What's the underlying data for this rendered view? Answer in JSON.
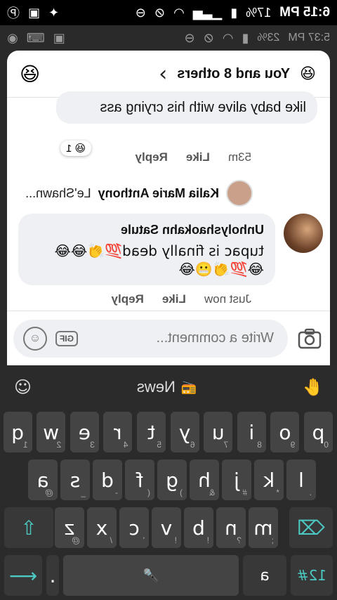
{
  "status": {
    "time": "6:15 PM",
    "battery": "17%",
    "signal_icon": "signal-icon",
    "wifi_icon": "wifi-icon"
  },
  "inner_status": {
    "time": "5:37 PM",
    "battery": "23%"
  },
  "header": {
    "title": "You and 8 others"
  },
  "comments": [
    {
      "text": "like baby alive with his crying ass",
      "reaction_count": "1",
      "time": "53m",
      "like": "Like",
      "reply": "Reply"
    },
    {
      "name": "Unholyshaokahn Satule",
      "text": "tupac is finally dead💯👏😂😂",
      "emoji_line": "😂💯👏😬😂",
      "time": "Just now",
      "like": "Like",
      "reply": "Reply"
    }
  ],
  "reply_preview": {
    "name": "Kalia Marie Anthony",
    "text": "Le'Shawn..."
  },
  "composer": {
    "placeholder": "Write a comment...",
    "gif": "GIF"
  },
  "keyboard": {
    "news_label": "News",
    "row1": [
      {
        "k": "q",
        "h": "1"
      },
      {
        "k": "w",
        "h": "2"
      },
      {
        "k": "e",
        "h": "3"
      },
      {
        "k": "r",
        "h": "4"
      },
      {
        "k": "t",
        "h": "5"
      },
      {
        "k": "y",
        "h": "6"
      },
      {
        "k": "u",
        "h": "7"
      },
      {
        "k": "i",
        "h": "8"
      },
      {
        "k": "o",
        "h": "9"
      },
      {
        "k": "p",
        "h": "0"
      }
    ],
    "row2": [
      {
        "k": "a",
        "h": "@"
      },
      {
        "k": "s",
        "h": "_"
      },
      {
        "k": "d",
        "h": "-"
      },
      {
        "k": "f",
        "h": "("
      },
      {
        "k": "g",
        "h": ")"
      },
      {
        "k": "h",
        "h": "&"
      },
      {
        "k": "j",
        "h": "#"
      },
      {
        "k": "k",
        "h": "*"
      },
      {
        "k": "l",
        "h": "."
      }
    ],
    "row3": [
      {
        "k": "z",
        "h": "@"
      },
      {
        "k": "x",
        "h": "/"
      },
      {
        "k": "c",
        "h": "'"
      },
      {
        "k": "v",
        "h": "!"
      },
      {
        "k": "b",
        "h": "!"
      },
      {
        "k": "n",
        "h": "?"
      },
      {
        "k": "m",
        "h": ";"
      }
    ],
    "numbers_key": "12#",
    "comma_key": "a",
    "accent_color": "#4bc9c2"
  }
}
